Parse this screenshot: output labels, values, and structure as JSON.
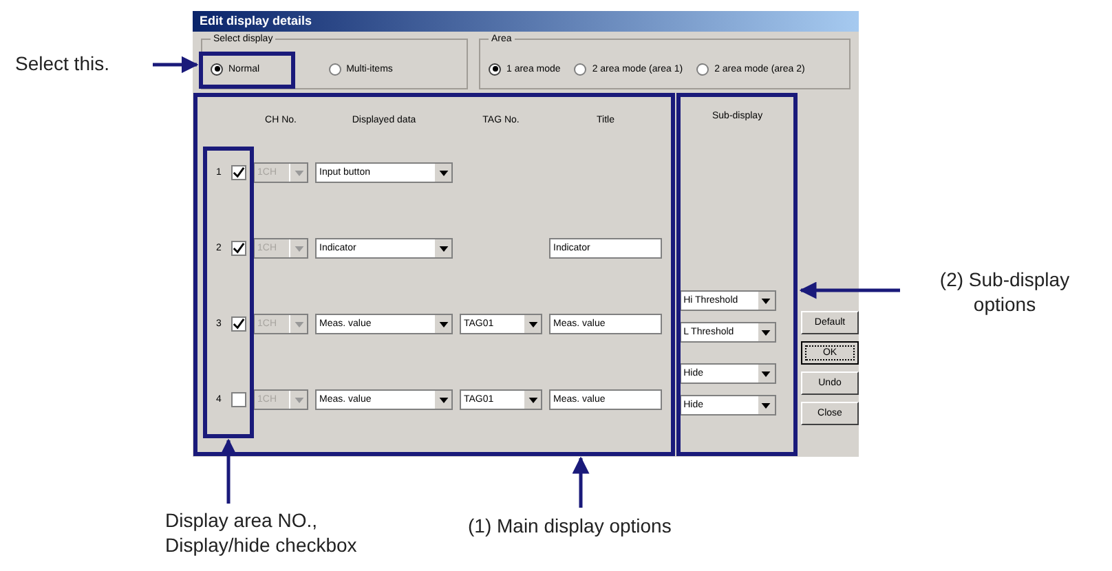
{
  "dialog": {
    "title": "Edit display details",
    "select_display": {
      "label": "Select display",
      "options": [
        {
          "label": "Normal",
          "selected": true
        },
        {
          "label": "Multi-items",
          "selected": false
        }
      ]
    },
    "area": {
      "label": "Area",
      "options": [
        {
          "label": "1 area mode",
          "selected": true
        },
        {
          "label": "2 area mode (area 1)",
          "selected": false
        },
        {
          "label": "2 area mode (area 2)",
          "selected": false
        }
      ]
    },
    "columns": [
      "CH No.",
      "Displayed data",
      "TAG No.",
      "Title"
    ],
    "sub_display_label": "Sub-display",
    "rows": [
      {
        "number": "1",
        "visible": true,
        "ch": "1CH",
        "displayed_data": "Input button"
      },
      {
        "number": "2",
        "visible": true,
        "ch": "1CH",
        "displayed_data": "Indicator",
        "title": "Indicator"
      },
      {
        "number": "3",
        "visible": true,
        "ch": "1CH",
        "displayed_data": "Meas. value",
        "tag_no": "TAG01",
        "title": "Meas. value"
      },
      {
        "number": "4",
        "visible": false,
        "ch": "1CH",
        "displayed_data": "Meas. value",
        "tag_no": "TAG01",
        "title": "Meas. value"
      }
    ],
    "sub_display": [
      "Hi Threshold",
      "L Threshold",
      "Hide",
      "Hide"
    ],
    "buttons": [
      {
        "label": "Default",
        "focused": false
      },
      {
        "label": "OK",
        "focused": true
      },
      {
        "label": "Undo",
        "focused": false
      },
      {
        "label": "Close",
        "focused": false
      }
    ]
  },
  "annotations": {
    "select": "Select this.",
    "sub": "(2) Sub-display options",
    "area_no": "Display area NO., Display/hide checkbox",
    "main": "(1) Main display options"
  }
}
